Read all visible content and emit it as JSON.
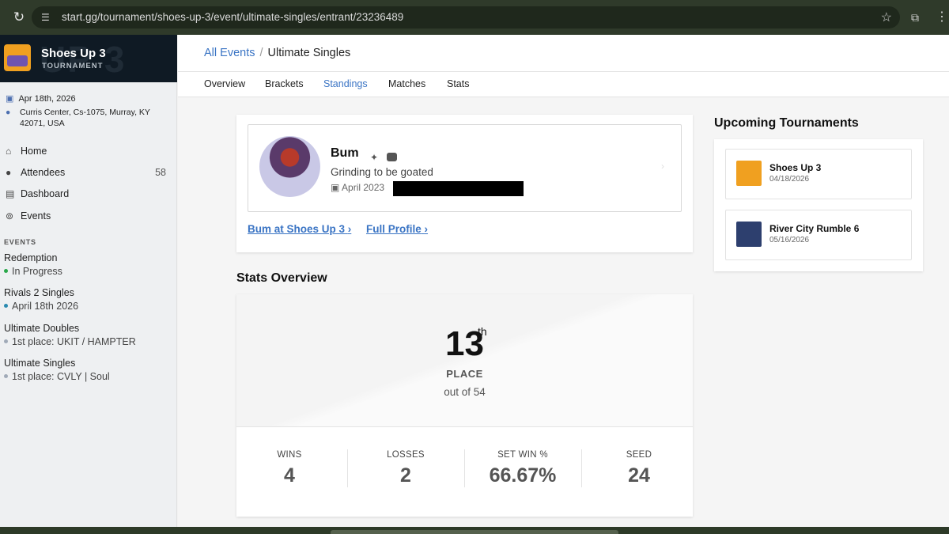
{
  "browser": {
    "url": "start.gg/tournament/shoes-up-3/event/ultimate-singles/entrant/23236489",
    "icons": {
      "reload": "reload-icon",
      "site": "site-settings-icon",
      "star": "bookmark-star-icon",
      "ext": "extensions-icon",
      "menu": "more-icon"
    }
  },
  "sidebar": {
    "title": "Shoes Up 3",
    "subtitle": "TOURNAMENT",
    "banner_text": "UP 3",
    "date": "Apr 18th, 2026",
    "location": "Curris Center, Cs-1075, Murray, KY 42071, USA",
    "nav": [
      {
        "label": "Home",
        "icon": "home-icon"
      },
      {
        "label": "Attendees",
        "icon": "person-icon",
        "count": "58"
      },
      {
        "label": "Dashboard",
        "icon": "dashboard-icon"
      },
      {
        "label": "Events",
        "icon": "gamepad-icon"
      }
    ],
    "events_header": "EVENTS",
    "events": [
      {
        "name": "Redemption",
        "status": "In Progress",
        "dot_color": "#2aa84a"
      },
      {
        "name": "Rivals 2 Singles",
        "status": "April 18th 2026",
        "dot_color": "#2a8ab0"
      },
      {
        "name": "Ultimate Doubles",
        "status": "1st place: UKIT / HAMPTER",
        "dot_color": "#a0aab8"
      },
      {
        "name": "Ultimate Singles",
        "status": "1st place: CVLY | Soul",
        "dot_color": "#a0aab8"
      }
    ]
  },
  "breadcrumb": {
    "parent": "All Events",
    "separator": "/",
    "current": "Ultimate Singles"
  },
  "tabs": [
    "Overview",
    "Brackets",
    "Standings",
    "Matches",
    "Stats"
  ],
  "active_tab": "Standings",
  "player": {
    "name": "Bum",
    "bio": "Grinding to be goated",
    "joined": "April 2023",
    "link_event": "Bum at Shoes Up 3",
    "link_profile": "Full Profile"
  },
  "stats": {
    "title": "Stats Overview",
    "place": "13",
    "place_suffix": "th",
    "place_label": "PLACE",
    "out_of": "out of 54",
    "items": [
      {
        "label": "WINS",
        "value": "4"
      },
      {
        "label": "LOSSES",
        "value": "2"
      },
      {
        "label": "SET WIN %",
        "value": "66.67%"
      },
      {
        "label": "SEED",
        "value": "24"
      }
    ]
  },
  "upcoming": {
    "title": "Upcoming Tournaments",
    "items": [
      {
        "name": "Shoes Up 3",
        "date": "04/18/2026",
        "logo_color": "#f0a020"
      },
      {
        "name": "River City Rumble 6",
        "date": "05/16/2026",
        "logo_color": "#2d3f6e"
      }
    ]
  }
}
